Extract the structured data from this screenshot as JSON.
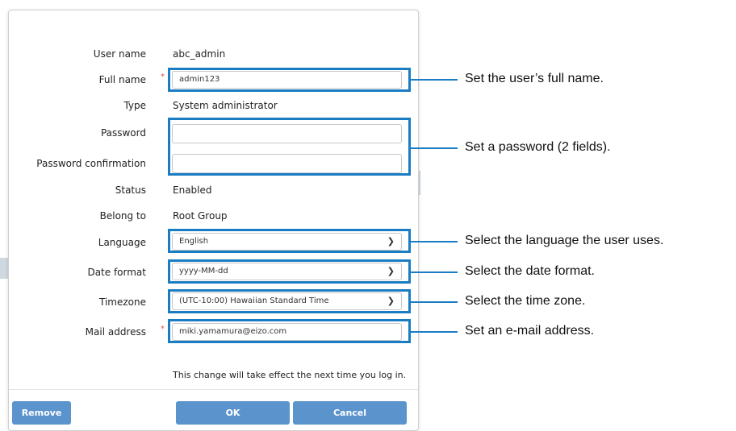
{
  "form": {
    "user_name": {
      "label": "User name",
      "value": "abc_admin"
    },
    "full_name": {
      "label": "Full name",
      "required_mark": "*",
      "value": "admin123"
    },
    "type": {
      "label": "Type",
      "value": "System administrator"
    },
    "password": {
      "label": "Password",
      "value": ""
    },
    "password_confirmation": {
      "label": "Password confirmation",
      "value": ""
    },
    "status": {
      "label": "Status",
      "value": "Enabled"
    },
    "belong_to": {
      "label": "Belong to",
      "value": "Root Group"
    },
    "language": {
      "label": "Language",
      "selected": "English"
    },
    "date_format": {
      "label": "Date format",
      "selected": "yyyy-MM-dd"
    },
    "timezone": {
      "label": "Timezone",
      "selected": "(UTC-10:00) Hawaiian Standard Time"
    },
    "mail_address": {
      "label": "Mail address",
      "required_mark": "*",
      "value": "miki.yamamura@eizo.com"
    },
    "notice": "This change will take effect the next time you log in."
  },
  "buttons": {
    "remove": "Remove",
    "ok": "OK",
    "cancel": "Cancel"
  },
  "annotations": {
    "full_name": "Set the user’s full name.",
    "password": "Set a password (2 fields).",
    "language": "Select the language the user uses.",
    "date_format": "Select the date format.",
    "timezone": "Select the time zone.",
    "mail": "Set an e-mail address."
  },
  "colors": {
    "highlight": "#1a7dc4",
    "button": "#5b93cc",
    "required": "#d9534f"
  },
  "icons": {
    "dropdown": "chevron-down-icon"
  }
}
